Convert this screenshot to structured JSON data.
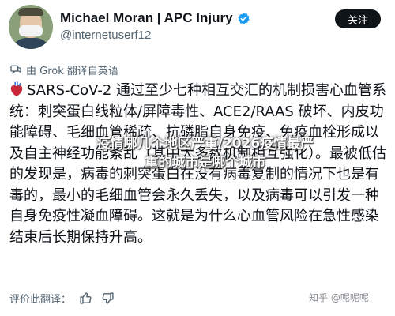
{
  "header": {
    "display_name": "Michael Moran | APC Injury",
    "handle": "@internetuserf12",
    "follow_label": "关注",
    "verified_color": "#1d9bf0"
  },
  "translation": {
    "label": "由 Grok 翻译自英语",
    "icon": "translate-icon"
  },
  "tweet": {
    "emoji": "anatomical-heart-icon",
    "text": "SARS-CoV-2 通过至少七种相互交汇的机制损害心血管系统：刺突蛋白线粒体/屏障毒性、ACE2/RAAS 破坏、内皮功能障碍、毛细血管稀疏、抗磷脂自身免疫、免疫血栓形成以及自主神经功能紊乱（其中大多数机制相互强化）。最被低估的发现是，病毒的刺突蛋白在没有病毒复制的情况下也是有毒的，最小的毛细血管会永久丢失，以及病毒可以引发一种自身免疫性凝血障碍。这就是为什么心血管风险在急性感染结束后长期保持升高。"
  },
  "overlay": {
    "line1": "疫情哪几个地区严重/2026疫情最严",
    "line2": "重的城市是哪个城市"
  },
  "footer": {
    "rate_label": "评价此翻译：",
    "thumbs_up_icon": "thumbs-up-icon",
    "thumbs_down_icon": "thumbs-down-icon"
  },
  "watermark": {
    "text": "知乎 @呢呢呢"
  }
}
